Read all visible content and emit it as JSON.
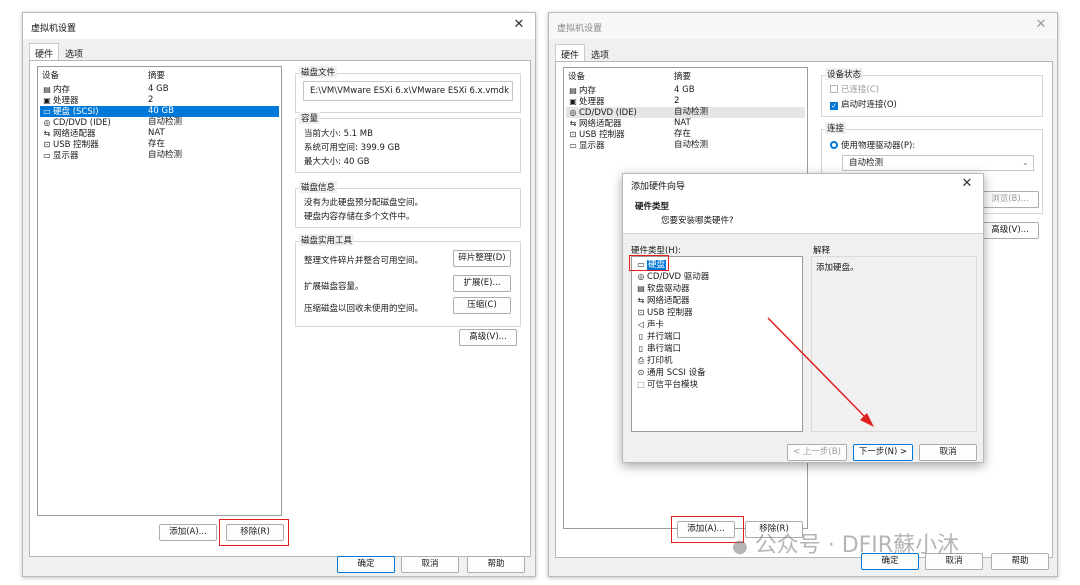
{
  "left": {
    "title": "虚拟机设置",
    "tabs": [
      "硬件",
      "选项"
    ],
    "headers": [
      "设备",
      "摘要"
    ],
    "devices": [
      {
        "icon": "内",
        "name": "内存",
        "summary": "4 GB"
      },
      {
        "icon": "▣",
        "name": "处理器",
        "summary": "2"
      },
      {
        "icon": "▭",
        "name": "硬盘 (SCSI)",
        "summary": "40 GB"
      },
      {
        "icon": "◎",
        "name": "CD/DVD (IDE)",
        "summary": "自动检测"
      },
      {
        "icon": "⇆",
        "name": "网络适配器",
        "summary": "NAT"
      },
      {
        "icon": "⊡",
        "name": "USB 控制器",
        "summary": "存在"
      },
      {
        "icon": "▭",
        "name": "显示器",
        "summary": "自动检测"
      }
    ],
    "disk_file": {
      "label": "磁盘文件",
      "path": "E:\\VM\\VMware ESXi 6.x\\VMware ESXi 6.x.vmdk"
    },
    "capacity": {
      "label": "容量",
      "current": "当前大小: 5.1 MB",
      "available": "系统可用空间: 399.9 GB",
      "max": "最大大小: 40 GB"
    },
    "disk_info": {
      "label": "磁盘信息",
      "line1": "没有为此硬盘预分配磁盘空间。",
      "line2": "硬盘内容存储在多个文件中。"
    },
    "utilities": {
      "label": "磁盘实用工具",
      "items": [
        {
          "text": "整理文件碎片并整合可用空间。",
          "button": "碎片整理(D)"
        },
        {
          "text": "扩展磁盘容量。",
          "button": "扩展(E)..."
        },
        {
          "text": "压缩磁盘以回收未使用的空间。",
          "button": "压缩(C)"
        }
      ]
    },
    "advanced": "高级(V)...",
    "add": "添加(A)...",
    "remove": "移除(R)",
    "ok": "确定",
    "cancel": "取消",
    "help": "帮助"
  },
  "right": {
    "title": "虚拟机设置",
    "tabs": [
      "硬件",
      "选项"
    ],
    "headers": [
      "设备",
      "摘要"
    ],
    "devices": [
      {
        "icon": "内",
        "name": "内存",
        "summary": "4 GB"
      },
      {
        "icon": "▣",
        "name": "处理器",
        "summary": "2"
      },
      {
        "icon": "◎",
        "name": "CD/DVD (IDE)",
        "summary": "自动检测"
      },
      {
        "icon": "⇆",
        "name": "网络适配器",
        "summary": "NAT"
      },
      {
        "icon": "⊡",
        "name": "USB 控制器",
        "summary": "存在"
      },
      {
        "icon": "▭",
        "name": "显示器",
        "summary": "自动检测"
      }
    ],
    "device_status": {
      "label": "设备状态",
      "connected": "已连接(C)",
      "connect_on_start": "启动时连接(O)"
    },
    "connection": {
      "label": "连接",
      "physical": "使用物理驱动器(P):",
      "drive_value": "自动检测",
      "browse": "浏览(B)..."
    },
    "advanced": "高级(V)...",
    "add": "添加(A)...",
    "remove": "移除(R)",
    "ok": "确定",
    "cancel": "取消",
    "help": "帮助"
  },
  "wizard": {
    "title": "添加硬件向导",
    "heading": "硬件类型",
    "subheading": "您要安装哪类硬件?",
    "types_label": "硬件类型(H):",
    "explain_label": "解释",
    "explain_text": "添加硬盘。",
    "types": [
      {
        "icon": "▭",
        "name": "硬盘"
      },
      {
        "icon": "◎",
        "name": "CD/DVD 驱动器"
      },
      {
        "icon": "▤",
        "name": "软盘驱动器"
      },
      {
        "icon": "⇆",
        "name": "网络适配器"
      },
      {
        "icon": "⊡",
        "name": "USB 控制器"
      },
      {
        "icon": "◁",
        "name": "声卡"
      },
      {
        "icon": "▯",
        "name": "并行端口"
      },
      {
        "icon": "▯",
        "name": "串行端口"
      },
      {
        "icon": "⎙",
        "name": "打印机"
      },
      {
        "icon": "⊙",
        "name": "通用 SCSI 设备"
      },
      {
        "icon": "⬚",
        "name": "可信平台模块"
      }
    ],
    "back": "< 上一步(B)",
    "next": "下一步(N) >",
    "cancel": "取消"
  },
  "watermark": "公众号 · DFIR蘇小沐",
  "colors": {
    "selection": "#0078d7",
    "annotation": "#e02020"
  }
}
